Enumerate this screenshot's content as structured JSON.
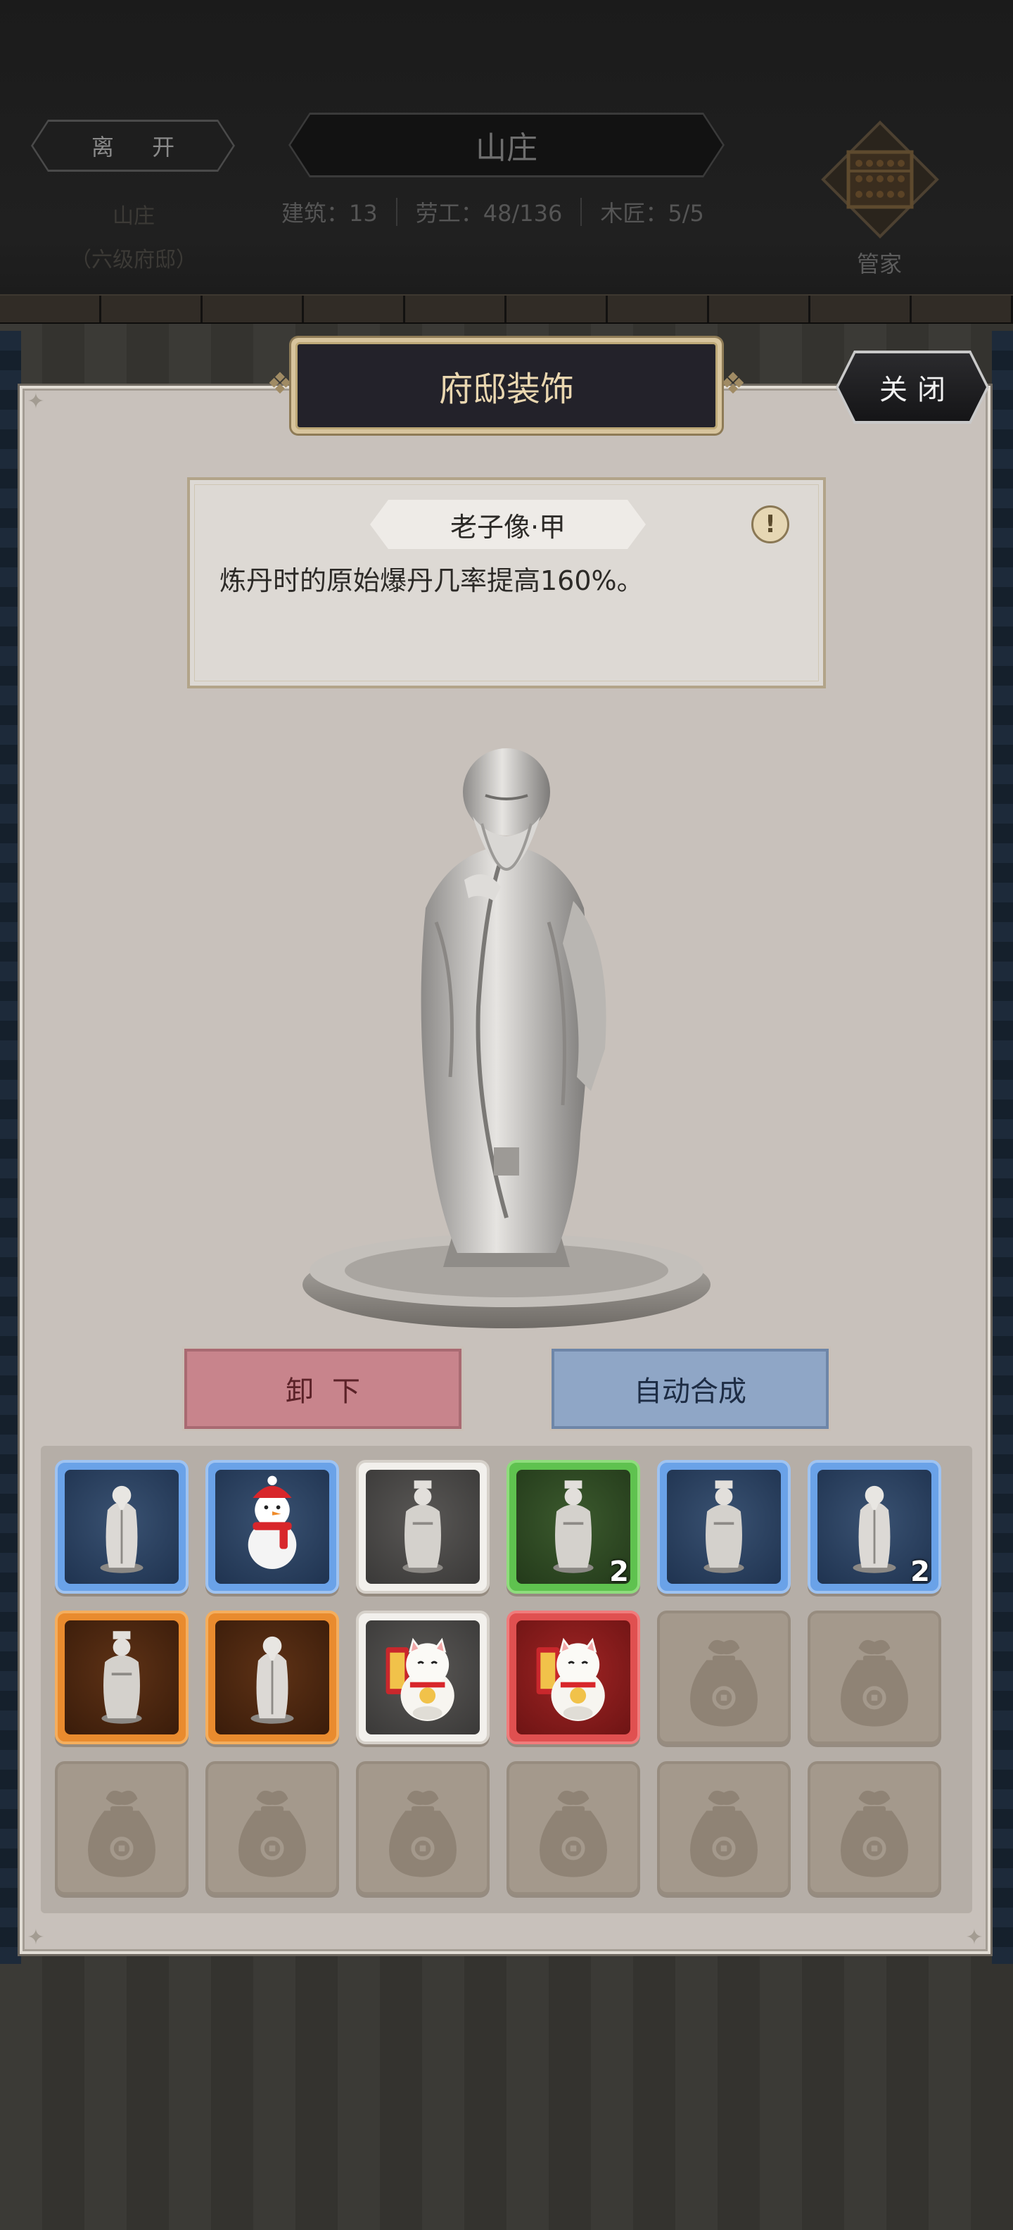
{
  "header": {
    "leave_label": "离 开",
    "location_name": "山庄",
    "location_level": "（六级府邸）",
    "title": "山庄",
    "stats": {
      "buildings": "建筑：13",
      "laborers": "劳工：48/136",
      "carpenters": "木匠：5/5"
    },
    "steward_label": "管家"
  },
  "panel": {
    "title": "府邸装饰",
    "close_label": "关闭"
  },
  "selected_item": {
    "name": "老子像·甲",
    "description": "炼丹时的原始爆丹几率提高160%。",
    "info_icon": "!"
  },
  "actions": {
    "remove_label": "卸下",
    "auto_merge_label": "自动合成"
  },
  "inventory": {
    "slots": [
      {
        "rarity": "blue",
        "item": "laozi-statue"
      },
      {
        "rarity": "blue",
        "item": "snowman"
      },
      {
        "rarity": "white",
        "item": "sage-statue"
      },
      {
        "rarity": "green",
        "item": "sage-statue",
        "qty": "2"
      },
      {
        "rarity": "blue",
        "item": "sage-statue"
      },
      {
        "rarity": "blue",
        "item": "laozi-statue",
        "qty": "2"
      },
      {
        "rarity": "orange",
        "item": "sage-statue"
      },
      {
        "rarity": "orange",
        "item": "laozi-statue"
      },
      {
        "rarity": "white",
        "item": "lucky-cat"
      },
      {
        "rarity": "red",
        "item": "lucky-cat"
      },
      {
        "rarity": "empty",
        "item": "bag-icon"
      },
      {
        "rarity": "empty",
        "item": "bag-icon"
      },
      {
        "rarity": "empty",
        "item": "bag-icon"
      },
      {
        "rarity": "empty",
        "item": "bag-icon"
      },
      {
        "rarity": "empty",
        "item": "bag-icon"
      },
      {
        "rarity": "empty",
        "item": "bag-icon"
      },
      {
        "rarity": "empty",
        "item": "bag-icon"
      },
      {
        "rarity": "empty",
        "item": "bag-icon"
      }
    ]
  },
  "colors": {
    "panel_bg": "#c8c1bb",
    "title_gold": "#ead7b0",
    "remove_red": "#c8848c",
    "merge_blue": "#8fa6c6"
  }
}
